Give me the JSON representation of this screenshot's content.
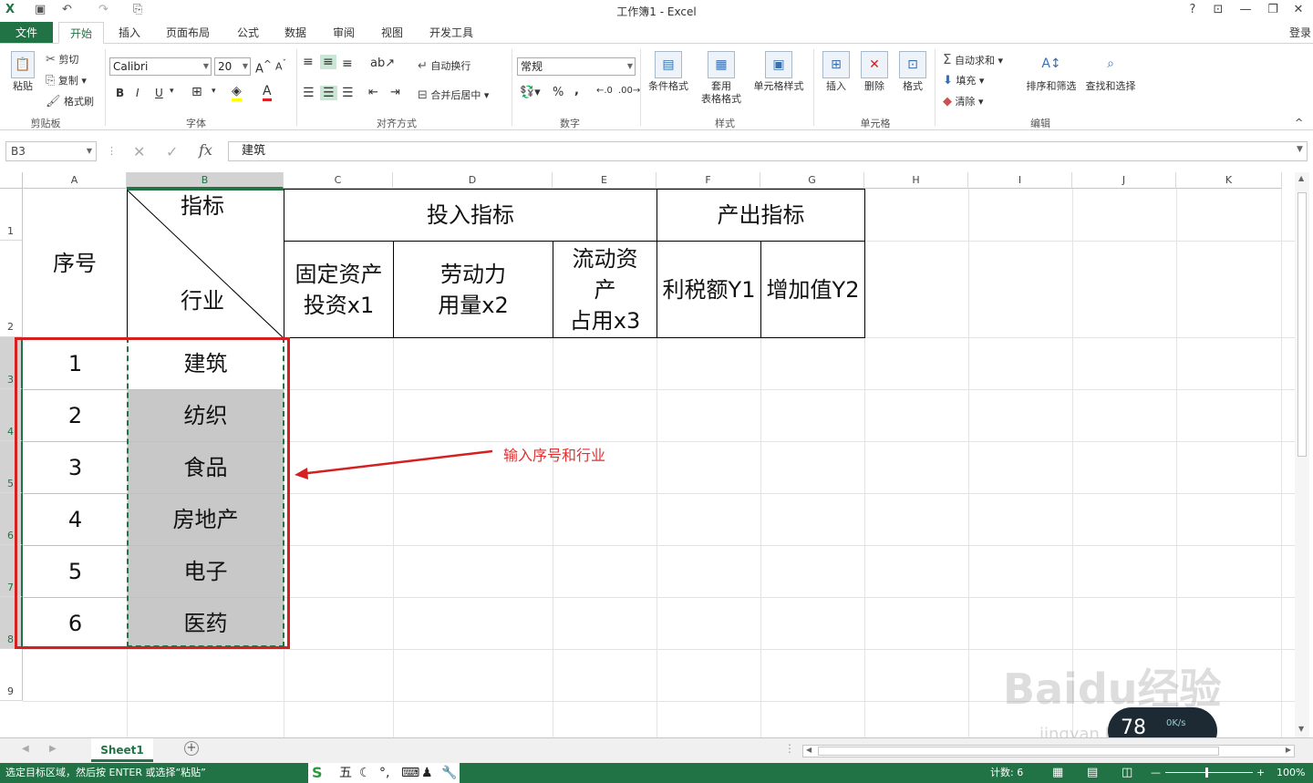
{
  "window": {
    "title": "工作簿1 - Excel",
    "help": "?",
    "login": "登录"
  },
  "tabs": [
    "文件",
    "开始",
    "插入",
    "页面布局",
    "公式",
    "数据",
    "审阅",
    "视图",
    "开发工具"
  ],
  "ribbon": {
    "clipboard": {
      "paste": "粘贴",
      "cut": "剪切",
      "copy": "复制",
      "format_painter": "格式刷",
      "label": "剪贴板"
    },
    "font": {
      "name": "Calibri",
      "size": "20",
      "label": "字体",
      "bold": "B",
      "italic": "I",
      "underline": "U"
    },
    "alignment": {
      "wrap": "自动换行",
      "merge": "合并后居中",
      "label": "对齐方式"
    },
    "number": {
      "format": "常规",
      "percent": "%",
      "comma": ",",
      "label": "数字"
    },
    "styles": {
      "conditional": "条件格式",
      "table1": "套用",
      "table2": "表格格式",
      "cell_styles": "单元格样式",
      "label": "样式"
    },
    "cells": {
      "insert": "插入",
      "delete": "删除",
      "format": "格式",
      "label": "单元格"
    },
    "editing": {
      "autosum": "自动求和",
      "fill": "填充",
      "clear": "清除",
      "sort": "排序和筛选",
      "find": "查找和选择",
      "label": "编辑"
    }
  },
  "formula_bar": {
    "name_box": "B3",
    "fx": "fx",
    "content": "建筑"
  },
  "columns": [
    "A",
    "B",
    "C",
    "D",
    "E",
    "F",
    "G",
    "H",
    "I",
    "J",
    "K"
  ],
  "rows": [
    "1",
    "2",
    "3",
    "4",
    "5",
    "6",
    "7",
    "8",
    "9"
  ],
  "sheet": {
    "seq_header": "序号",
    "diag_top": "指标",
    "diag_bottom": "行业",
    "input_header": "投入指标",
    "output_header": "产出指标",
    "c2_line1": "固定资产",
    "c2_line2": "投资x1",
    "d2_line1": "劳动力",
    "d2_line2": "用量x2",
    "e2_line1": "流动资",
    "e2_line2": "产",
    "e2_line3": "占用x3",
    "f2": "利税额Y1",
    "g2": "增加值Y2",
    "data_rows": [
      {
        "seq": "1",
        "industry": "建筑"
      },
      {
        "seq": "2",
        "industry": "纺织"
      },
      {
        "seq": "3",
        "industry": "食品"
      },
      {
        "seq": "4",
        "industry": "房地产"
      },
      {
        "seq": "5",
        "industry": "电子"
      },
      {
        "seq": "6",
        "industry": "医药"
      }
    ]
  },
  "annotation": "输入序号和行业",
  "sheet_tab": "Sheet1",
  "status": {
    "message": "选定目标区域，然后按 ENTER 或选择“粘贴”",
    "count": "计数: 6",
    "zoom": "100%"
  },
  "widget": {
    "value": "78",
    "speed": "0K/s"
  },
  "watermark": {
    "brand": "Baidu经验",
    "url": "jingyan.baidu.com"
  },
  "ime": {
    "label": "五"
  },
  "colors": {
    "excel_green": "#217346",
    "selection_red": "#d42020",
    "shade_gray": "#c8c8c8"
  }
}
